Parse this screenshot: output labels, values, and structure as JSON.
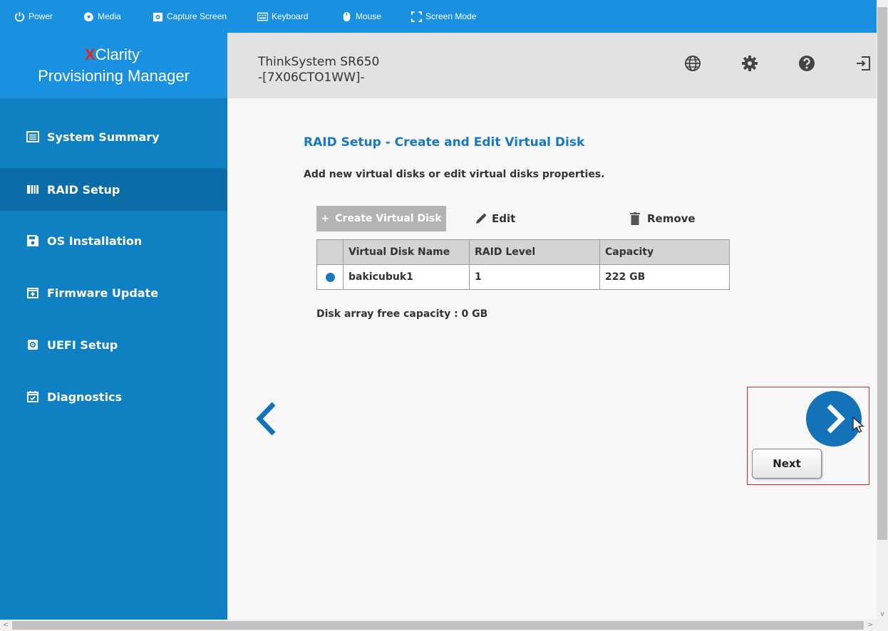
{
  "toolbar": {
    "power": "Power",
    "media": "Media",
    "capture": "Capture Screen",
    "keyboard": "Keyboard",
    "mouse": "Mouse",
    "screen_mode": "Screen Mode"
  },
  "brand": {
    "x": "X",
    "clarity": "Clarity",
    "tm": "·",
    "line2": "Provisioning Manager"
  },
  "header": {
    "system_line1": "ThinkSystem SR650",
    "system_line2": "-[7X06CTO1WW]-",
    "icons": [
      "globe-icon",
      "gear-icon",
      "help-icon",
      "exit-icon"
    ]
  },
  "sidebar": {
    "items": [
      {
        "label": "System Summary",
        "icon": "list-icon",
        "active": false
      },
      {
        "label": "RAID Setup",
        "icon": "raid-icon",
        "active": true
      },
      {
        "label": "OS Installation",
        "icon": "save-icon",
        "active": false
      },
      {
        "label": "Firmware Update",
        "icon": "upload-icon",
        "active": false
      },
      {
        "label": "UEFI Setup",
        "icon": "chip-icon",
        "active": false
      },
      {
        "label": "Diagnostics",
        "icon": "calendar-check-icon",
        "active": false
      }
    ]
  },
  "main": {
    "title": "RAID Setup - Create and Edit Virtual Disk",
    "description": "Add new virtual disks or edit virtual disks properties.",
    "create_label": "Create Virtual Disk",
    "create_plus": "+",
    "edit_label": "Edit",
    "remove_label": "Remove",
    "table": {
      "headers": [
        "Virtual Disk Name",
        "RAID Level",
        "Capacity"
      ],
      "rows": [
        {
          "selected": true,
          "name": "bakicubuk1",
          "raid_level": "1",
          "capacity": "222 GB"
        }
      ]
    },
    "free_capacity": "Disk array free capacity : 0 GB",
    "next_label": "Next"
  },
  "colors": {
    "toolbar": "#1a91e0",
    "sidebar": "#0f80c1",
    "sidebar_active": "#0a6da8",
    "accent": "#1878c0",
    "highlight_box": "#d7262b"
  }
}
